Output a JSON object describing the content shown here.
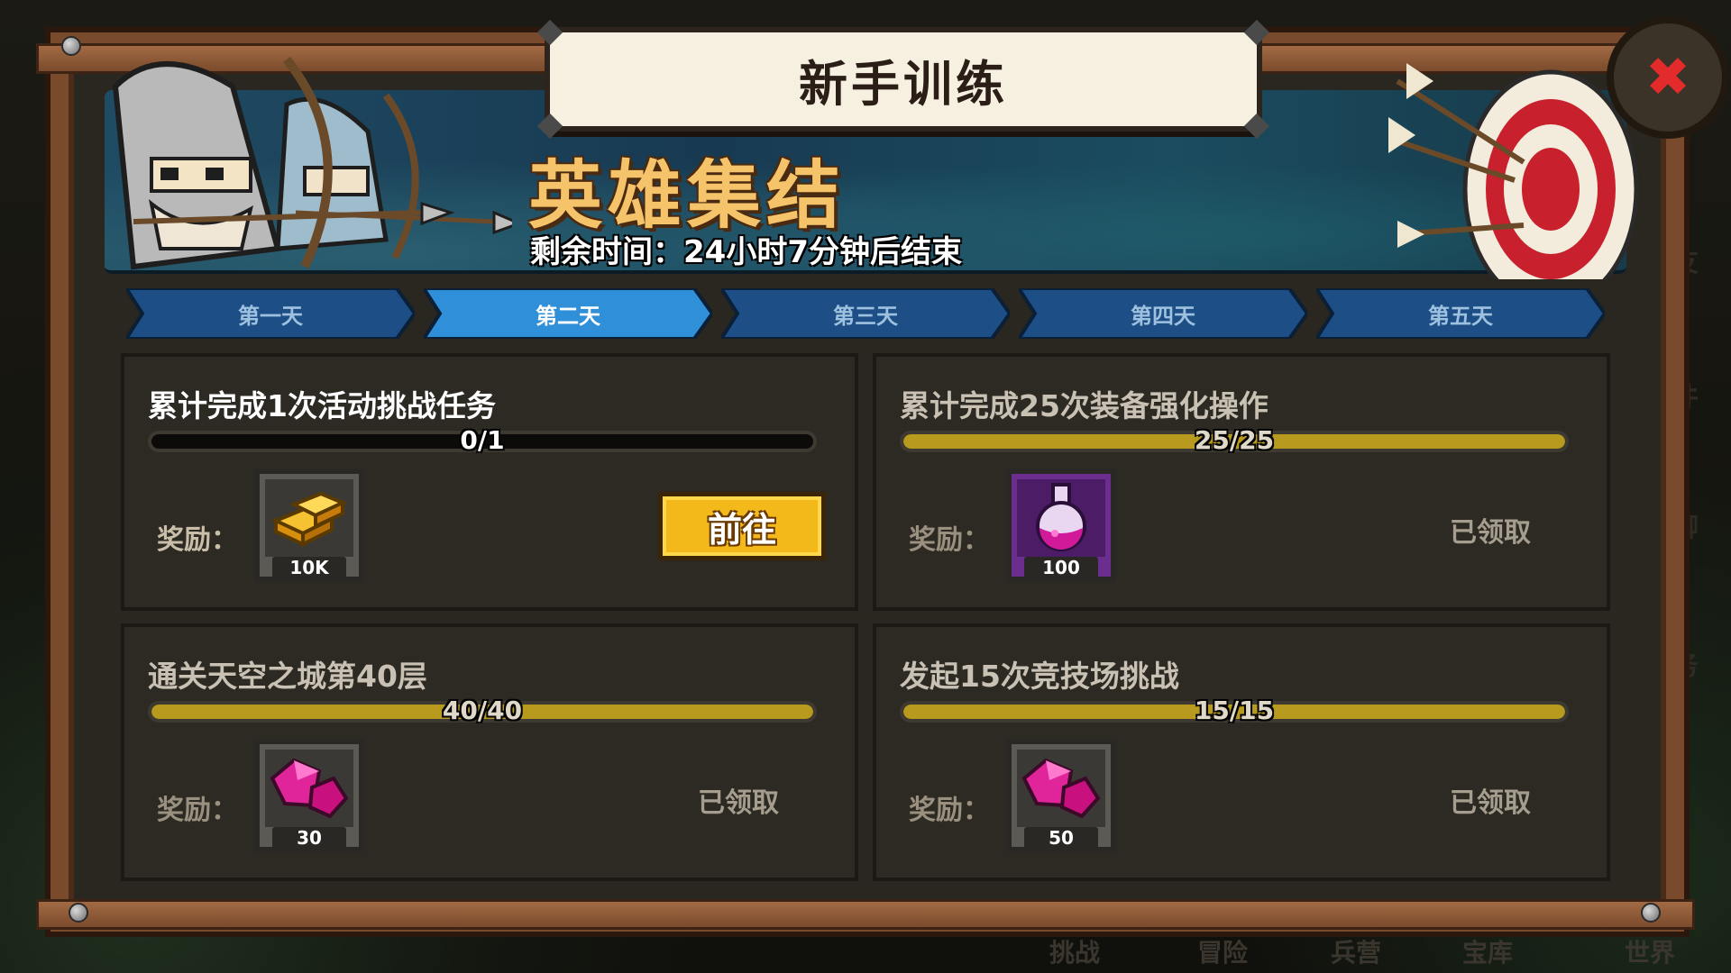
{
  "window": {
    "title": "新手训练",
    "close_icon": "close-icon"
  },
  "banner": {
    "event_title": "英雄集结",
    "countdown": "剩余时间：24小时7分钟后结束"
  },
  "tabs": [
    {
      "label": "第一天",
      "active": false
    },
    {
      "label": "第二天",
      "active": true
    },
    {
      "label": "第三天",
      "active": false
    },
    {
      "label": "第四天",
      "active": false
    },
    {
      "label": "第五天",
      "active": false
    }
  ],
  "tasks": [
    {
      "title": "累计完成1次活动挑战任务",
      "progress_text": "0/1",
      "progress": 0.0,
      "reward_label": "奖励：",
      "reward_icon": "gold-bars-icon",
      "reward_qty": "10K",
      "action": "前往",
      "status": "open"
    },
    {
      "title": "累计完成25次装备强化操作",
      "progress_text": "25/25",
      "progress": 1.0,
      "reward_label": "奖励：",
      "reward_icon": "potion-flask-icon",
      "reward_qty": "100",
      "action": "已领取",
      "status": "claimed"
    },
    {
      "title": "通关天空之城第40层",
      "progress_text": "40/40",
      "progress": 1.0,
      "reward_label": "奖励：",
      "reward_icon": "pink-gem-icon",
      "reward_qty": "30",
      "action": "已领取",
      "status": "claimed"
    },
    {
      "title": "发起15次竞技场挑战",
      "progress_text": "15/15",
      "progress": 1.0,
      "reward_label": "奖励：",
      "reward_icon": "pink-gem-icon",
      "reward_qty": "50",
      "action": "已领取",
      "status": "claimed"
    }
  ],
  "background": {
    "bottom_nav": [
      "挑战",
      "冒险",
      "兵营",
      "宝库",
      "世界"
    ],
    "side_nav": [
      "友",
      "件",
      "聊",
      "务"
    ]
  },
  "colors": {
    "accent_gold": "#f3b81a",
    "progress_fill": "#b89a1e",
    "tab_active": "#2f8fd8",
    "tab_inactive": "#1d4f86",
    "close_red": "#e32b2b"
  }
}
